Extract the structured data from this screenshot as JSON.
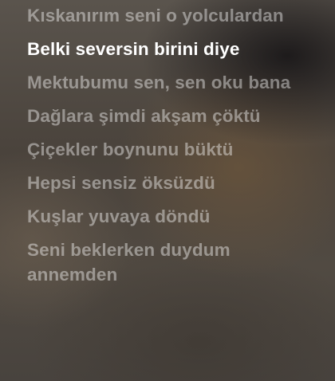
{
  "lyrics": {
    "lines": [
      "Kıskanırım seni o yolculardan",
      "Belki seversin birini diye",
      "Mektubumu sen, sen oku bana",
      "Dağlara şimdi akşam çöktü",
      "Çiçekler boynunu büktü",
      "Hepsi sensiz öksüzdü",
      "Kuşlar yuvaya döndü",
      "Seni beklerken duydum annemden"
    ],
    "active_line_index": 1
  },
  "colors": {
    "active_text": "#ffffff",
    "inactive_text": "rgba(255,255,255,0.42)"
  }
}
